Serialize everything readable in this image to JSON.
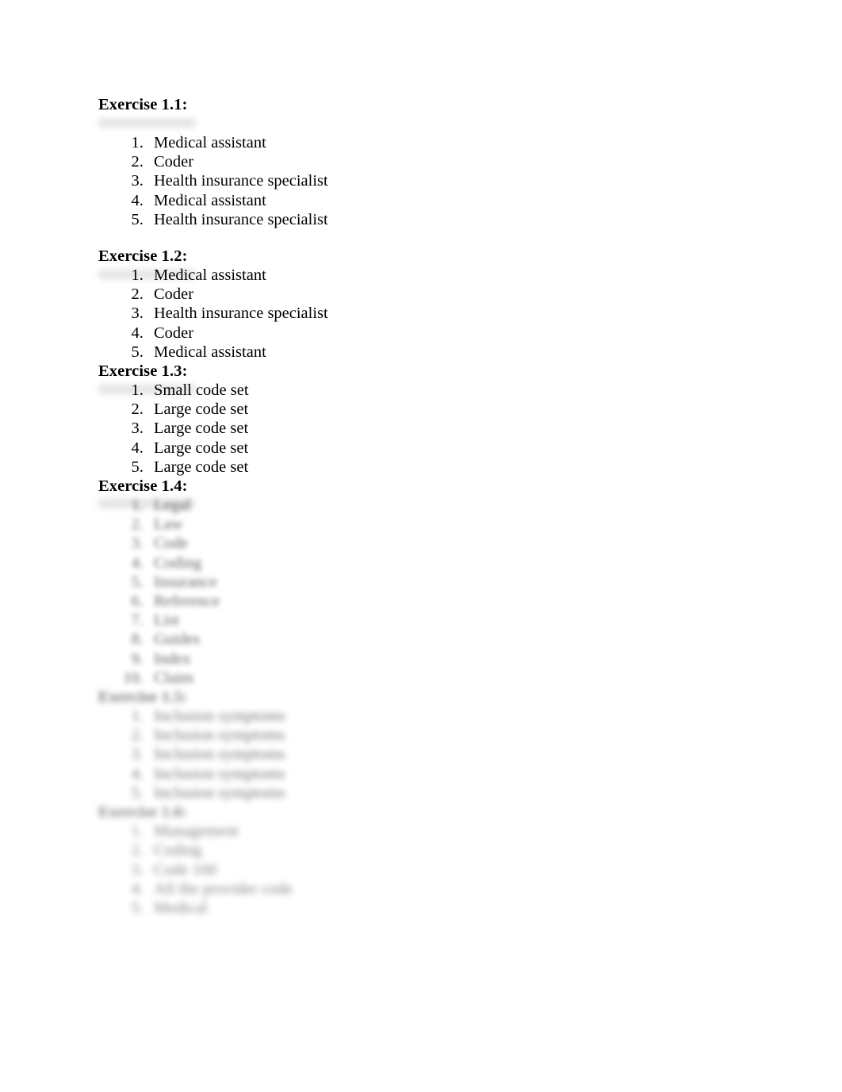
{
  "document": {
    "sections": [
      {
        "heading": "Exercise 1.1:",
        "items": [
          "Medical assistant",
          "Coder",
          "Health insurance specialist",
          "Medical assistant",
          "Health insurance specialist"
        ]
      },
      {
        "heading": "Exercise 1.2:",
        "items": [
          "Medical assistant",
          "Coder",
          "Health insurance specialist",
          "Coder",
          "Medical assistant"
        ]
      },
      {
        "heading": "Exercise 1.3:",
        "items": [
          "Small code set",
          "Large code set",
          "Large code set",
          "Large code set",
          "Large code set"
        ]
      },
      {
        "heading": "Exercise 1.4:",
        "items": [
          "Legal",
          "Law",
          "Code",
          "Coding",
          "Insurance",
          "Reference",
          "List",
          "Guides",
          "Index",
          "Claim"
        ]
      },
      {
        "heading": "Exercise 1.5:",
        "items": [
          "Inclusion symptoms",
          "Inclusion symptoms",
          "Inclusion symptoms",
          "Inclusion symptoms",
          "Inclusion symptoms"
        ]
      },
      {
        "heading": "Exercise 1.6:",
        "items": [
          "Management",
          "Coding",
          "Code  100",
          "All the provider code",
          "Medical"
        ]
      }
    ]
  }
}
